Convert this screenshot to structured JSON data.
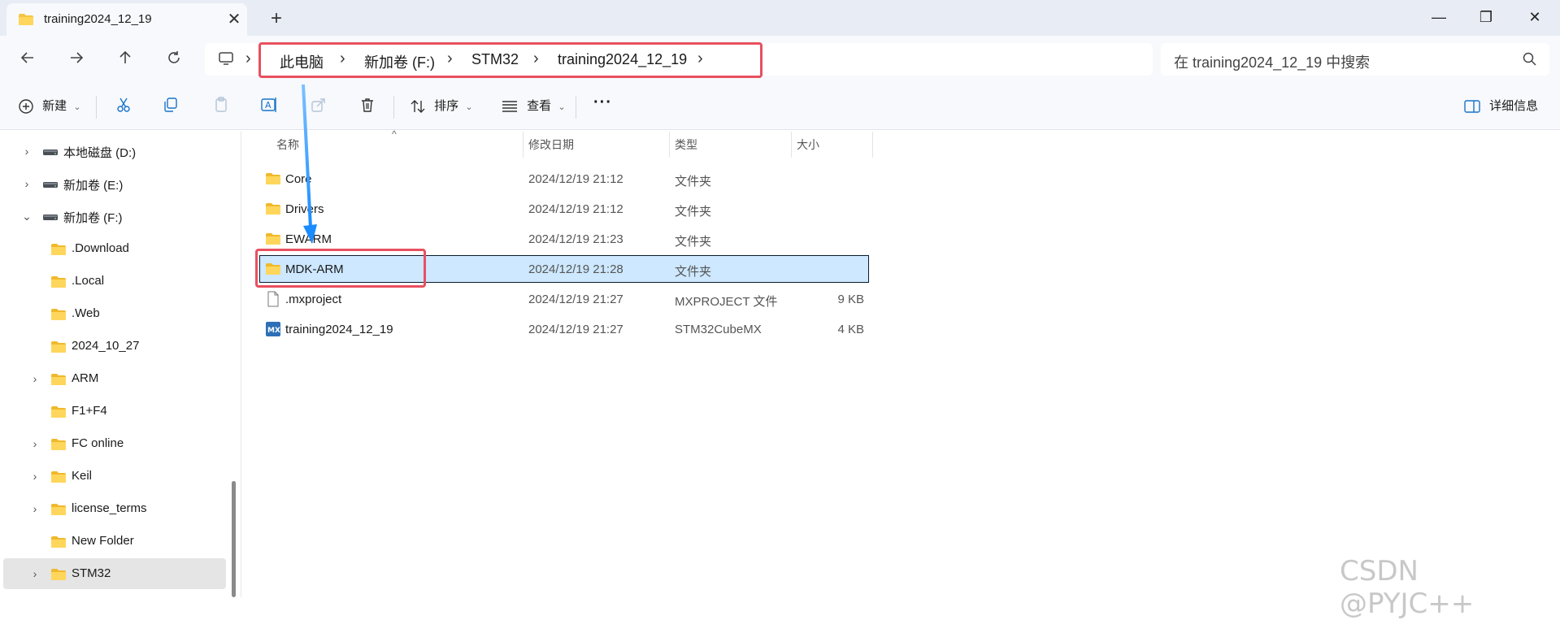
{
  "window": {
    "tab_title": "training2024_12_19",
    "new_tab_symbol": "+",
    "close_tab_symbol": "✕",
    "minimize_symbol": "—",
    "restore_symbol": "❐",
    "close_symbol": "✕"
  },
  "address": {
    "breadcrumbs": [
      "此电脑",
      "新加卷 (F:)",
      "STM32",
      "training2024_12_19"
    ],
    "search_placeholder": "在 training2024_12_19 中搜索"
  },
  "toolbar": {
    "new_label": "新建",
    "sort_label": "排序",
    "view_label": "查看",
    "more_label": "···",
    "details_label": "详细信息"
  },
  "sidebar": {
    "items": [
      {
        "label": "本地磁盘 (D:)",
        "icon": "drive-icon",
        "expandable": true,
        "expanded": false
      },
      {
        "label": "新加卷 (E:)",
        "icon": "drive-icon",
        "expandable": true,
        "expanded": false
      },
      {
        "label": "新加卷 (F:)",
        "icon": "drive-icon",
        "expandable": true,
        "expanded": true
      },
      {
        "label": ".Download",
        "icon": "folder-icon",
        "expandable": false
      },
      {
        "label": ".Local",
        "icon": "folder-icon",
        "expandable": false
      },
      {
        "label": ".Web",
        "icon": "folder-icon",
        "expandable": false
      },
      {
        "label": "2024_10_27",
        "icon": "folder-icon",
        "expandable": false
      },
      {
        "label": "ARM",
        "icon": "folder-icon",
        "expandable": true
      },
      {
        "label": "F1+F4",
        "icon": "folder-icon",
        "expandable": false
      },
      {
        "label": "FC online",
        "icon": "folder-icon",
        "expandable": true
      },
      {
        "label": "Keil",
        "icon": "folder-icon",
        "expandable": true
      },
      {
        "label": "license_terms",
        "icon": "folder-icon",
        "expandable": true
      },
      {
        "label": "New Folder",
        "icon": "folder-icon",
        "expandable": false
      },
      {
        "label": "STM32",
        "icon": "folder-icon",
        "expandable": true,
        "selected": true
      }
    ]
  },
  "list": {
    "columns": [
      "名称",
      "修改日期",
      "类型",
      "大小"
    ],
    "rows": [
      {
        "name": "Core",
        "date": "2024/12/19 21:12",
        "type": "文件夹",
        "size": "",
        "icon": "folder-icon"
      },
      {
        "name": "Drivers",
        "date": "2024/12/19 21:12",
        "type": "文件夹",
        "size": "",
        "icon": "folder-icon"
      },
      {
        "name": "EWARM",
        "date": "2024/12/19 21:23",
        "type": "文件夹",
        "size": "",
        "icon": "folder-icon"
      },
      {
        "name": "MDK-ARM",
        "date": "2024/12/19 21:28",
        "type": "文件夹",
        "size": "",
        "icon": "folder-icon",
        "selected": true
      },
      {
        "name": ".mxproject",
        "date": "2024/12/19 21:27",
        "type": "MXPROJECT 文件",
        "size": "9 KB",
        "icon": "file-icon"
      },
      {
        "name": "training2024_12_19",
        "date": "2024/12/19 21:27",
        "type": "STM32CubeMX",
        "size": "4 KB",
        "icon": "stm32cubemx-icon"
      }
    ]
  },
  "annotation": {
    "highlight_color": "#e8505f",
    "arrow_color": "#1a8cff"
  },
  "watermark": "CSDN @PYJC++"
}
